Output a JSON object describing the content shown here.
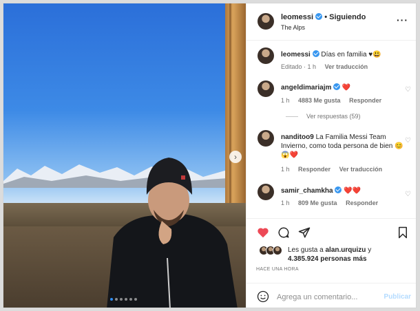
{
  "post": {
    "author": "leomessi",
    "follow_separator": "•",
    "follow_label": "Siguiendo",
    "location": "The Alps",
    "more_icon": "more-horizontal-icon"
  },
  "caption": {
    "user": "leomessi",
    "text": "Días en familia",
    "emoji": "♥😃",
    "edited": "Editado · 1 h",
    "translate": "Ver traducción"
  },
  "comments": [
    {
      "user": "angeldimariajm",
      "text": "",
      "emoji": "❤️",
      "time": "1 h",
      "likes": "4883 Me gusta",
      "reply": "Responder",
      "view_replies": "Ver respuestas (59)"
    },
    {
      "user": "nanditoo9",
      "text": "La Familia Messi Team Invierno, como toda persona de bien",
      "emoji": "😊😱❤️",
      "time": "1 h",
      "reply": "Responder",
      "translate": "Ver traducción"
    },
    {
      "user": "samir_chamkha",
      "text": "",
      "emoji": "❤️❤️",
      "time": "1 h",
      "likes": "809 Me gusta",
      "reply": "Responder"
    }
  ],
  "likes": {
    "prefix": "Les gusta a",
    "user": "alan.urquizu",
    "connector": "y",
    "count": "4.385.924 personas más"
  },
  "timestamp": "HACE UNA HORA",
  "add_comment": {
    "placeholder": "Agrega un comentario...",
    "publish": "Publicar"
  },
  "carousel": {
    "slides": 8,
    "active": 1
  },
  "colors": {
    "like_red": "#ed4956",
    "verified_blue": "#3897f0",
    "publish_blue": "#b3dbff"
  }
}
